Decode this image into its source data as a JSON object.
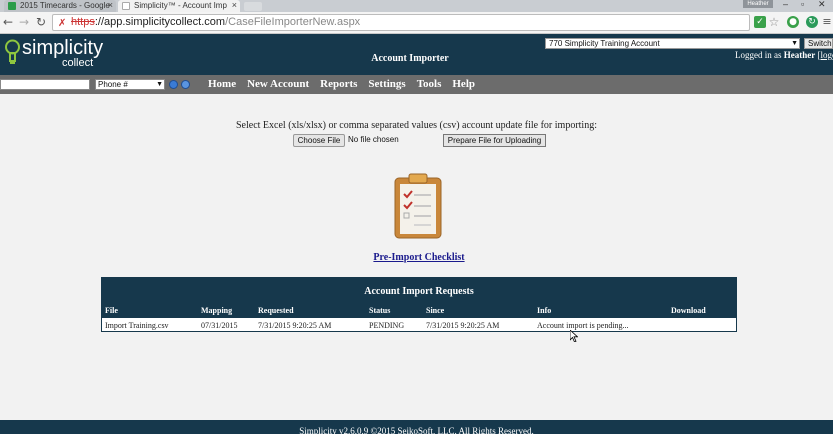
{
  "browser": {
    "tabs": [
      {
        "title": "2015 Timecards - Google",
        "active": false
      },
      {
        "title": "Simplicity™ - Account Imp",
        "active": true
      }
    ],
    "user_badge": "Heather",
    "url": {
      "scheme": "https",
      "host": "://app.simplicitycollect.com",
      "path": "/CaseFileImporterNew.aspx"
    }
  },
  "header": {
    "logo_main": "simplicity",
    "logo_sub": "collect",
    "title": "Account Importer",
    "account_selected": "770 Simplicity Training Account",
    "switch_label": "Switch",
    "logged_in_prefix": "Logged in as",
    "logged_in_user": "Heather",
    "logout_label": "logo"
  },
  "navbar": {
    "search_type": "Phone #",
    "menu": [
      "Home",
      "New Account",
      "Reports",
      "Settings",
      "Tools",
      "Help"
    ]
  },
  "importer": {
    "prompt": "Select Excel (xls/xlsx) or comma separated values (csv) account update file for importing:",
    "choose_file_label": "Choose File",
    "no_file_label": "No file chosen",
    "prepare_label": "Prepare File for Uploading",
    "checklist_link": "Pre-Import Checklist"
  },
  "requests": {
    "title": "Account Import Requests",
    "columns": [
      "File",
      "Mapping",
      "Requested",
      "Status",
      "Since",
      "Info",
      "Download"
    ],
    "rows": [
      [
        "Import Training.csv",
        "07/31/2015",
        "7/31/2015 9:20:25 AM",
        "PENDING",
        "7/31/2015 9:20:25 AM",
        "Account import is pending...",
        ""
      ]
    ]
  },
  "footer": {
    "text": "Simplicity v2.6.0.9 ©2015 SeikoSoft, LLC. All Rights Reserved."
  },
  "colors": {
    "brand_dark": "#16384c",
    "nav_gray": "#6c6c6c",
    "link_blue": "#1a1a8c"
  }
}
